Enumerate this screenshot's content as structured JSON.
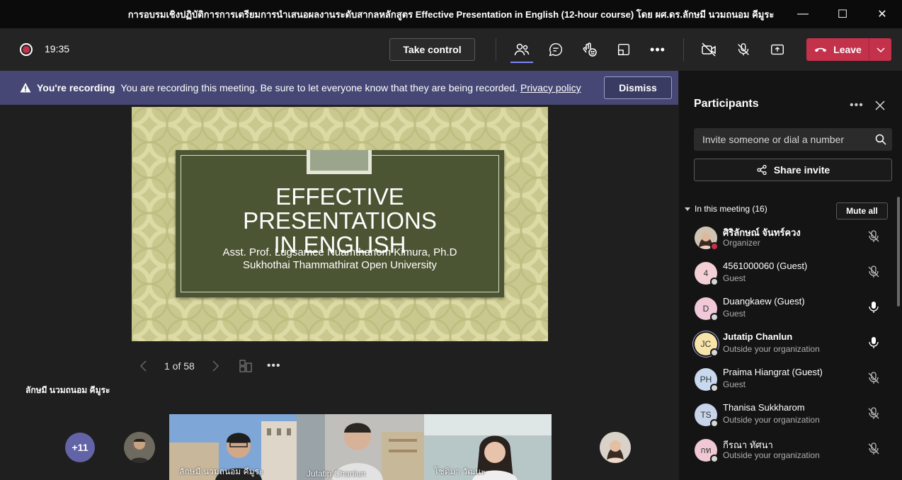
{
  "window": {
    "title": "การอบรมเชิงปฏิบัติการการเตรียมการนำเสนอผลงานระดับสากลหลักสูตร Effective Presentation in English (12-hour course) โดย ผศ.ดร.ลักษมี นวมถนอม คีมูระ"
  },
  "toolbar": {
    "timer": "19:35",
    "take_control": "Take control",
    "leave": "Leave",
    "leave_color": "#c4314b"
  },
  "banner": {
    "title": "You're recording",
    "message": "You are recording this meeting. Be sure to let everyone know that they are being recorded.",
    "link": "Privacy policy",
    "dismiss": "Dismiss",
    "bg": "#464775"
  },
  "slide": {
    "title_line1": "EFFECTIVE PRESENTATIONS",
    "title_line2": "IN ENGLISH",
    "subtitle_line1": "Asst. Prof. Lugsamee Nuamthanom Kimura, Ph.D",
    "subtitle_line2": "Sukhothai Thammathirat Open University",
    "page_indicator": "1 of 58"
  },
  "presenter_name": "ลักษมี นวมถนอม คีมูระ",
  "video_strip": {
    "overflow_count": "+11",
    "tiles": [
      {
        "label": "ลักษมี นวมถนอม คีมูระ"
      },
      {
        "label": "Jutatip Chanlun"
      },
      {
        "label": "โชติมา วัฒนะ"
      }
    ]
  },
  "participants": {
    "title": "Participants",
    "invite_placeholder": "Invite someone or dial a number",
    "share_invite": "Share invite",
    "section_label": "In this meeting (16)",
    "mute_all": "Mute all",
    "list": [
      {
        "name": "ศิริลักษณ์ จันทร์ควง",
        "role": "Organizer",
        "initials": "",
        "av_color": "#b98a72",
        "mic": "muted"
      },
      {
        "name": "4561000060 (Guest)",
        "role": "Guest",
        "initials": "4",
        "av_color": "#f4cfd6",
        "mic": "muted"
      },
      {
        "name": "Duangkaew (Guest)",
        "role": "Guest",
        "initials": "D",
        "av_color": "#f0c8d8",
        "mic": "on"
      },
      {
        "name": "Jutatip Chanlun",
        "role": "Outside your organization",
        "initials": "JC",
        "av_color": "#f6e4a8",
        "mic": "on"
      },
      {
        "name": "Praima Hiangrat (Guest)",
        "role": "Guest",
        "initials": "PH",
        "av_color": "#c8d8ee",
        "mic": "muted"
      },
      {
        "name": "Thanisa Sukkharom",
        "role": "Outside your organization",
        "initials": "TS",
        "av_color": "#c8d4ea",
        "mic": "muted"
      },
      {
        "name": "กีรณา ทัศนา",
        "role": "Outside your organization",
        "initials": "กท",
        "av_color": "#f0c8d4",
        "mic": "muted"
      }
    ]
  }
}
